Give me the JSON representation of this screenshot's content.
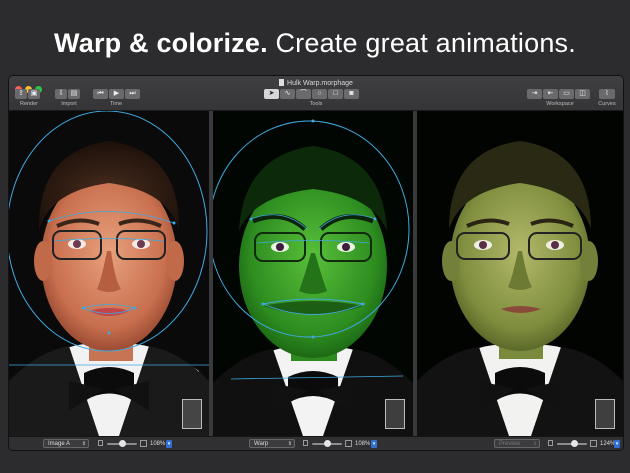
{
  "headline": {
    "bold": "Warp & colorize.",
    "rest": " Create great animations."
  },
  "window": {
    "title": "Hulk Warp.morphage"
  },
  "toolbar": {
    "render_label": "Render",
    "import_label": "Import",
    "time_label": "Time",
    "tools_label": "Tools",
    "workspace_label": "Workspace",
    "curves_label": "Curves"
  },
  "panes": {
    "left": {
      "selector": "Image A",
      "zoom": "108%"
    },
    "middle": {
      "selector": "Warp",
      "zoom": "108%"
    },
    "right": {
      "selector": "Preview",
      "zoom": "124%"
    }
  },
  "colors": {
    "accent": "#2f6fd6",
    "warp_line": "#3fa9e0",
    "warp_tint": "#1f8a1f"
  }
}
